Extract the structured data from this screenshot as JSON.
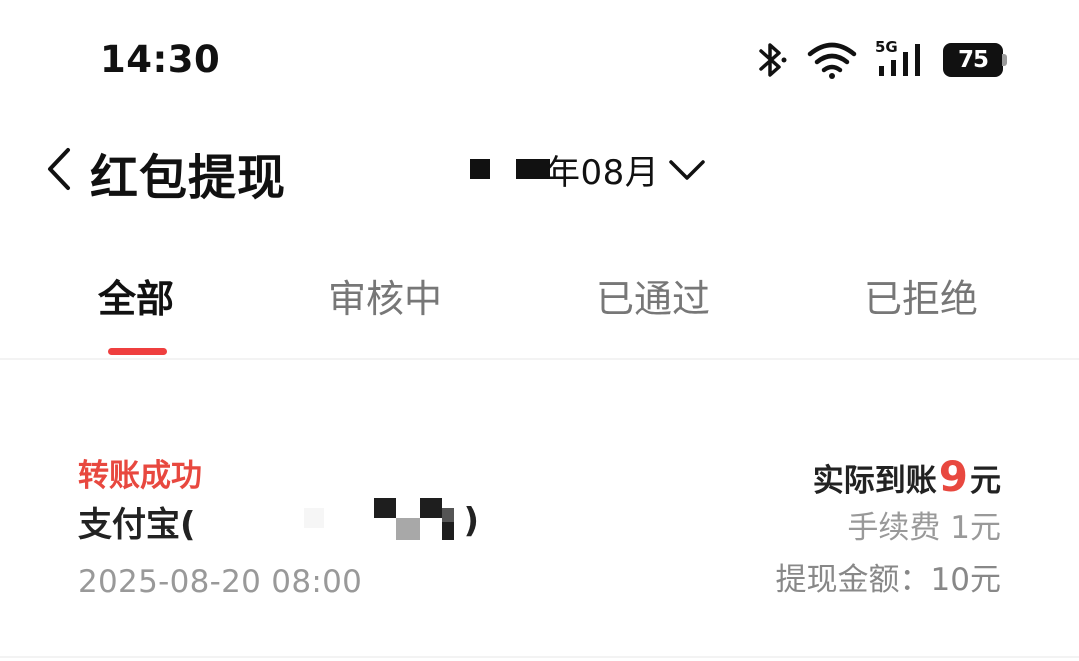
{
  "status_bar": {
    "time": "14:30",
    "network": "5G",
    "battery": "75",
    "icons": [
      "bluetooth-icon",
      "wifi-icon",
      "cellular-signal-icon",
      "battery-icon"
    ]
  },
  "header": {
    "title": "红包提现",
    "month_label": "年08月"
  },
  "tabs": [
    {
      "label": "全部",
      "active": true
    },
    {
      "label": "审核中",
      "active": false
    },
    {
      "label": "已通过",
      "active": false
    },
    {
      "label": "已拒绝",
      "active": false
    }
  ],
  "colors": {
    "accent_red": "#e8483f",
    "indicator_red": "#ef3f3f"
  },
  "records": [
    {
      "status": "转账成功",
      "account_prefix": "支付宝(",
      "account_suffix": ")",
      "time": "2025-08-20 08:00",
      "actual_label": "实际到账",
      "actual_amount": "9",
      "actual_unit": "元",
      "fee": "手续费 1元",
      "total": "提现金额：10元"
    }
  ]
}
